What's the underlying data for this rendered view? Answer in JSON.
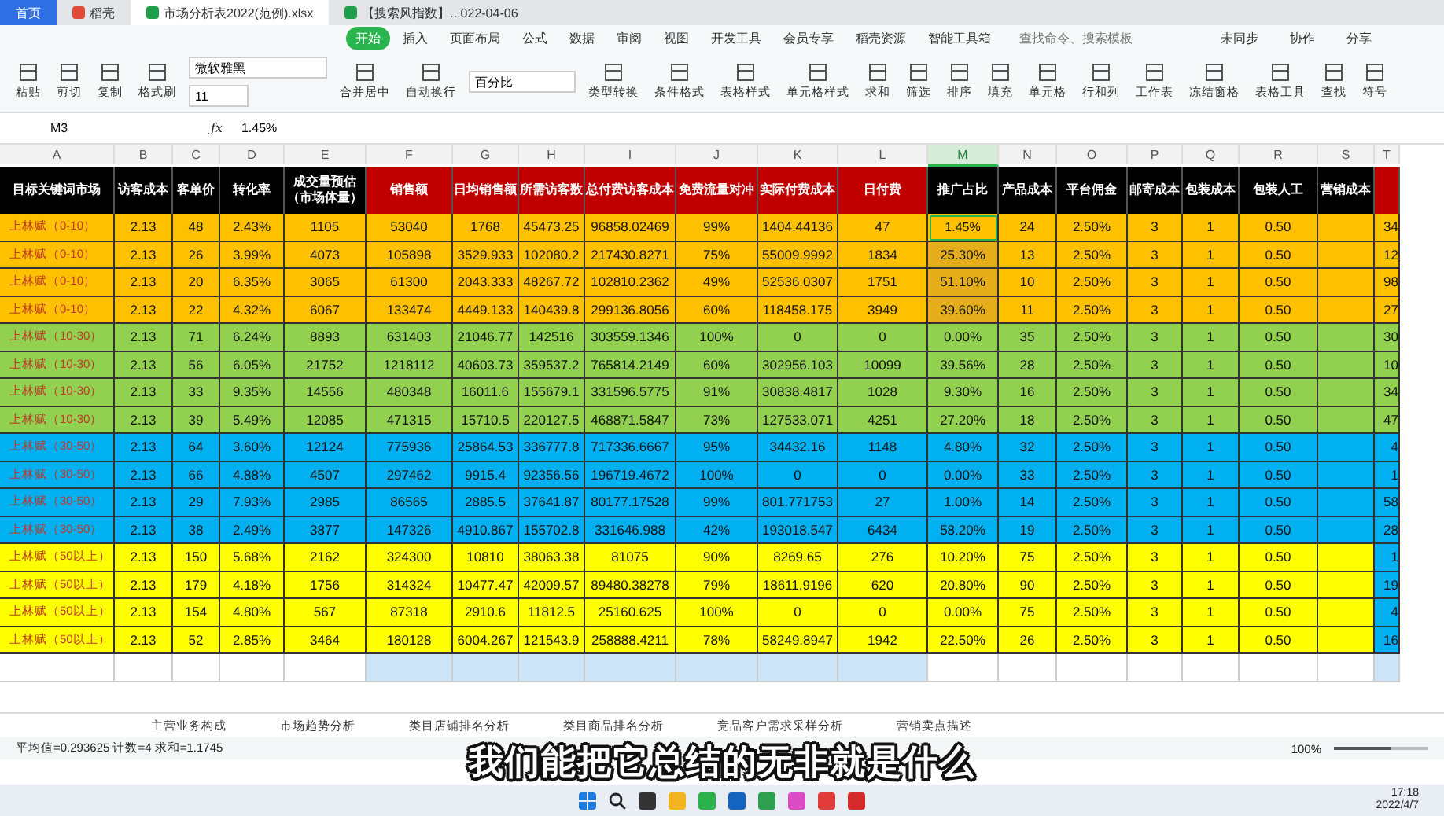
{
  "title_tabs": [
    {
      "label": "首页",
      "kind": "home",
      "selected": false
    },
    {
      "label": "稻壳",
      "kind": "doc",
      "selected": false
    },
    {
      "label": "市场分析表2022(范例).xlsx",
      "kind": "sheet",
      "selected": true
    },
    {
      "label": "【搜索风指数】...022-04-06",
      "kind": "sheet",
      "selected": false
    }
  ],
  "menu": [
    {
      "label": "开始",
      "selected": true
    },
    {
      "label": "插入",
      "selected": false
    },
    {
      "label": "页面布局",
      "selected": false
    },
    {
      "label": "公式",
      "selected": false
    },
    {
      "label": "数据",
      "selected": false
    },
    {
      "label": "审阅",
      "selected": false
    },
    {
      "label": "视图",
      "selected": false
    },
    {
      "label": "开发工具",
      "selected": false
    },
    {
      "label": "会员专享",
      "selected": false
    },
    {
      "label": "稻壳资源",
      "selected": false
    },
    {
      "label": "智能工具箱",
      "selected": false
    }
  ],
  "command_search": {
    "placeholder": "查找命令、搜索模板"
  },
  "account_actions": [
    "未同步",
    "协作",
    "分享"
  ],
  "toolbar": {
    "clipboard": [
      "粘贴",
      "剪切",
      "复制",
      "格式刷"
    ],
    "font": "微软雅黑",
    "font_size": "11",
    "cells": [
      "合并居中",
      "自动换行"
    ],
    "number_format": "百分比",
    "styles": [
      "类型转换",
      "条件格式",
      "表格样式",
      "单元格样式"
    ],
    "editing": [
      "求和",
      "筛选",
      "排序",
      "填充",
      "单元格",
      "行和列",
      "工作表",
      "冻结窗格",
      "表格工具",
      "查找",
      "符号"
    ]
  },
  "formula_bar": {
    "cell": "M3",
    "function_label": "ƒx",
    "formula": "1.45%"
  },
  "sheet": {
    "columns": [
      {
        "letter": "A",
        "selected": false
      },
      {
        "letter": "B",
        "selected": false
      },
      {
        "letter": "C",
        "selected": false
      },
      {
        "letter": "D",
        "selected": false
      },
      {
        "letter": "E",
        "selected": false
      },
      {
        "letter": "F",
        "selected": false
      },
      {
        "letter": "G",
        "selected": false
      },
      {
        "letter": "H",
        "selected": false
      },
      {
        "letter": "I",
        "selected": false
      },
      {
        "letter": "J",
        "selected": false
      },
      {
        "letter": "K",
        "selected": false
      },
      {
        "letter": "L",
        "selected": false
      },
      {
        "letter": "M",
        "selected": true
      },
      {
        "letter": "N",
        "selected": false
      },
      {
        "letter": "O",
        "selected": false
      },
      {
        "letter": "P",
        "selected": false
      },
      {
        "letter": "Q",
        "selected": false
      },
      {
        "letter": "R",
        "selected": false
      },
      {
        "letter": "S",
        "selected": false
      },
      {
        "letter": "T",
        "selected": false
      }
    ],
    "header": [
      {
        "text": "目标关键词市场",
        "color": "#000000"
      },
      {
        "text": "访客成本",
        "color": "#000000"
      },
      {
        "text": "客单价",
        "color": "#000000"
      },
      {
        "text": "转化率",
        "color": "#000000"
      },
      {
        "text": "成交量预估（市场体量）",
        "color": "#000000"
      },
      {
        "text": "销售额",
        "color": "#c00000"
      },
      {
        "text": "日均销售额",
        "color": "#c00000"
      },
      {
        "text": "所需访客数",
        "color": "#c00000"
      },
      {
        "text": "总付费访客成本",
        "color": "#c00000"
      },
      {
        "text": "免费流量对冲",
        "color": "#c00000"
      },
      {
        "text": "实际付费成本",
        "color": "#c00000"
      },
      {
        "text": "日付费",
        "color": "#c00000"
      },
      {
        "text": "推广占比",
        "color": "#000000"
      },
      {
        "text": "产品成本",
        "color": "#000000"
      },
      {
        "text": "平台佣金",
        "color": "#000000"
      },
      {
        "text": "邮寄成本",
        "color": "#000000"
      },
      {
        "text": "包装成本",
        "color": "#000000"
      },
      {
        "text": "包装人工",
        "color": "#000000"
      },
      {
        "text": "营销成本",
        "color": "#000000"
      },
      {
        "color": "#c00000"
      }
    ],
    "rows": [
      {
        "color": "#ffc000",
        "selected": true,
        "cells": [
          "上林赋（0-10）",
          "2.13",
          "48",
          "2.43%",
          "1105",
          "53040",
          "1768",
          "45473.25",
          "96858.02469",
          "99%",
          "1404.44136",
          "47",
          "1.45%",
          "24",
          "2.50%",
          "3",
          "1",
          "0.50",
          ""
        ],
        "column_t": {
          "text": "34",
          "color": "#ffc000"
        }
      },
      {
        "color": "#ffc000",
        "selected": true,
        "cells": [
          "上林赋（0-10）",
          "2.13",
          "26",
          "3.99%",
          "4073",
          "105898",
          "3529.933",
          "102080.2",
          "217430.8271",
          "75%",
          "55009.9992",
          "1834",
          "25.30%",
          "13",
          "2.50%",
          "3",
          "1",
          "0.50",
          ""
        ],
        "column_t": {
          "text": "12",
          "color": "#ffc000"
        }
      },
      {
        "color": "#ffc000",
        "selected": true,
        "cells": [
          "上林赋（0-10）",
          "2.13",
          "20",
          "6.35%",
          "3065",
          "61300",
          "2043.333",
          "48267.72",
          "102810.2362",
          "49%",
          "52536.0307",
          "1751",
          "51.10%",
          "10",
          "2.50%",
          "3",
          "1",
          "0.50",
          ""
        ],
        "column_t": {
          "text": "98",
          "color": "#ffc000"
        }
      },
      {
        "color": "#ffc000",
        "selected": true,
        "cells": [
          "上林赋（0-10）",
          "2.13",
          "22",
          "4.32%",
          "6067",
          "133474",
          "4449.133",
          "140439.8",
          "299136.8056",
          "60%",
          "118458.175",
          "3949",
          "39.60%",
          "11",
          "2.50%",
          "3",
          "1",
          "0.50",
          ""
        ],
        "column_t": {
          "text": "27",
          "color": "#ffc000"
        }
      },
      {
        "color": "#92d050",
        "selected": false,
        "cells": [
          "上林赋（10-30）",
          "2.13",
          "71",
          "6.24%",
          "8893",
          "631403",
          "21046.77",
          "142516",
          "303559.1346",
          "100%",
          "0",
          "0",
          "0.00%",
          "35",
          "2.50%",
          "3",
          "1",
          "0.50",
          ""
        ],
        "column_t": {
          "text": "30",
          "color": "#92d050"
        }
      },
      {
        "color": "#92d050",
        "selected": false,
        "cells": [
          "上林赋（10-30）",
          "2.13",
          "56",
          "6.05%",
          "21752",
          "1218112",
          "40603.73",
          "359537.2",
          "765814.2149",
          "60%",
          "302956.103",
          "10099",
          "39.56%",
          "28",
          "2.50%",
          "3",
          "1",
          "0.50",
          ""
        ],
        "column_t": {
          "text": "10",
          "color": "#92d050"
        }
      },
      {
        "color": "#92d050",
        "selected": false,
        "cells": [
          "上林赋（10-30）",
          "2.13",
          "33",
          "9.35%",
          "14556",
          "480348",
          "16011.6",
          "155679.1",
          "331596.5775",
          "91%",
          "30838.4817",
          "1028",
          "9.30%",
          "16",
          "2.50%",
          "3",
          "1",
          "0.50",
          ""
        ],
        "column_t": {
          "text": "34",
          "color": "#92d050"
        }
      },
      {
        "color": "#92d050",
        "selected": false,
        "cells": [
          "上林赋（10-30）",
          "2.13",
          "39",
          "5.49%",
          "12085",
          "471315",
          "15710.5",
          "220127.5",
          "468871.5847",
          "73%",
          "127533.071",
          "4251",
          "27.20%",
          "18",
          "2.50%",
          "3",
          "1",
          "0.50",
          ""
        ],
        "column_t": {
          "text": "47",
          "color": "#92d050"
        }
      },
      {
        "color": "#00b0f0",
        "selected": false,
        "cells": [
          "上林赋（30-50）",
          "2.13",
          "64",
          "3.60%",
          "12124",
          "775936",
          "25864.53",
          "336777.8",
          "717336.6667",
          "95%",
          "34432.16",
          "1148",
          "4.80%",
          "32",
          "2.50%",
          "3",
          "1",
          "0.50",
          ""
        ],
        "column_t": {
          "text": "4",
          "color": "#00b0f0"
        }
      },
      {
        "color": "#00b0f0",
        "selected": false,
        "cells": [
          "上林赋（30-50）",
          "2.13",
          "66",
          "4.88%",
          "4507",
          "297462",
          "9915.4",
          "92356.56",
          "196719.4672",
          "100%",
          "0",
          "0",
          "0.00%",
          "33",
          "2.50%",
          "3",
          "1",
          "0.50",
          ""
        ],
        "column_t": {
          "text": "1",
          "color": "#00b0f0"
        }
      },
      {
        "color": "#00b0f0",
        "selected": false,
        "cells": [
          "上林赋（30-50）",
          "2.13",
          "29",
          "7.93%",
          "2985",
          "86565",
          "2885.5",
          "37641.87",
          "80177.17528",
          "99%",
          "801.771753",
          "27",
          "1.00%",
          "14",
          "2.50%",
          "3",
          "1",
          "0.50",
          ""
        ],
        "column_t": {
          "text": "58",
          "color": "#00b0f0"
        }
      },
      {
        "color": "#00b0f0",
        "selected": false,
        "cells": [
          "上林赋（30-50）",
          "2.13",
          "38",
          "2.49%",
          "3877",
          "147326",
          "4910.867",
          "155702.8",
          "331646.988",
          "42%",
          "193018.547",
          "6434",
          "58.20%",
          "19",
          "2.50%",
          "3",
          "1",
          "0.50",
          ""
        ],
        "column_t": {
          "text": "28",
          "color": "#00b0f0"
        }
      },
      {
        "color": "#ffff00",
        "selected": false,
        "cells": [
          "上林赋（50以上）",
          "2.13",
          "150",
          "5.68%",
          "2162",
          "324300",
          "10810",
          "38063.38",
          "81075",
          "90%",
          "8269.65",
          "276",
          "10.20%",
          "75",
          "2.50%",
          "3",
          "1",
          "0.50",
          ""
        ],
        "column_t": {
          "text": "1",
          "color": "#00b0f0"
        }
      },
      {
        "color": "#ffff00",
        "selected": false,
        "cells": [
          "上林赋（50以上）",
          "2.13",
          "179",
          "4.18%",
          "1756",
          "314324",
          "10477.47",
          "42009.57",
          "89480.38278",
          "79%",
          "18611.9196",
          "620",
          "20.80%",
          "90",
          "2.50%",
          "3",
          "1",
          "0.50",
          ""
        ],
        "column_t": {
          "text": "19",
          "color": "#00b0f0"
        }
      },
      {
        "color": "#ffff00",
        "selected": false,
        "cells": [
          "上林赋（50以上）",
          "2.13",
          "154",
          "4.80%",
          "567",
          "87318",
          "2910.6",
          "11812.5",
          "25160.625",
          "100%",
          "0",
          "0",
          "0.00%",
          "75",
          "2.50%",
          "3",
          "1",
          "0.50",
          ""
        ],
        "column_t": {
          "text": "4",
          "color": "#00b0f0"
        }
      },
      {
        "color": "#ffff00",
        "selected": false,
        "cells": [
          "上林赋（50以上）",
          "2.13",
          "52",
          "2.85%",
          "3464",
          "180128",
          "6004.267",
          "121543.9",
          "258888.4211",
          "78%",
          "58249.8947",
          "1942",
          "22.50%",
          "26",
          "2.50%",
          "3",
          "1",
          "0.50",
          ""
        ],
        "column_t": {
          "text": "16",
          "color": "#00b0f0"
        }
      }
    ]
  },
  "sheet_tabs": [
    {
      "label": "主营业务构成",
      "selected": false
    },
    {
      "label": "市场趋势分析",
      "selected": false
    },
    {
      "label": "类目店铺排名分析",
      "selected": false
    },
    {
      "label": "类目商品排名分析",
      "selected": false
    },
    {
      "label": "竞品客户需求采样分析",
      "selected": false
    },
    {
      "label": "营销卖点描述",
      "selected": false
    }
  ],
  "status_bar": {
    "summary": "平均值=0.293625  计数=4  求和=1.1745",
    "zoom": "100%",
    "level": 0.6
  },
  "subtitle": "我们能把它总结的无非就是什么",
  "taskbar": {
    "time": "17:18",
    "date": "2022/4/7"
  }
}
